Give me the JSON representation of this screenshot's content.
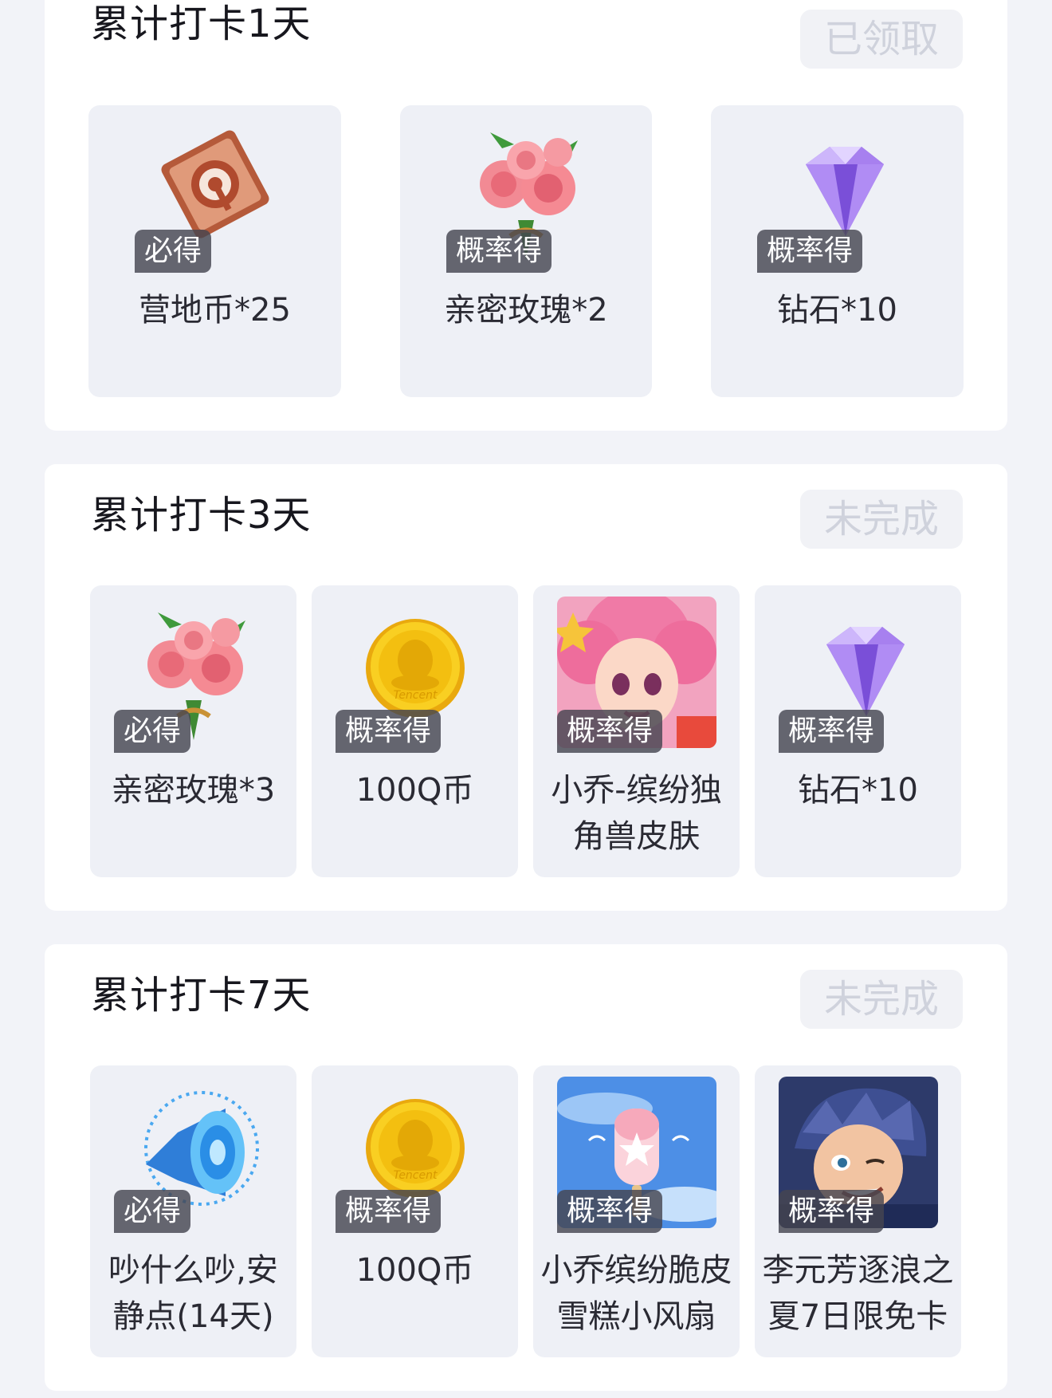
{
  "sections": [
    {
      "title": "累计打卡1天",
      "status": "已领取",
      "rewards": [
        {
          "tag": "必得",
          "label": "营地币*25",
          "icon": "camp-coin-icon"
        },
        {
          "tag": "概率得",
          "label": "亲密玫瑰*2",
          "icon": "rose-bouquet-icon"
        },
        {
          "tag": "概率得",
          "label": "钻石*10",
          "icon": "purple-diamond-icon"
        }
      ]
    },
    {
      "title": "累计打卡3天",
      "status": "未完成",
      "rewards": [
        {
          "tag": "必得",
          "label": "亲密玫瑰*3",
          "icon": "rose-bouquet-icon"
        },
        {
          "tag": "概率得",
          "label": "100Q币",
          "icon": "q-coin-icon"
        },
        {
          "tag": "概率得",
          "label": "小乔-缤纷独",
          "label2": "角兽皮肤",
          "icon": "xiaoqiao-skin-portrait"
        },
        {
          "tag": "概率得",
          "label": "钻石*10",
          "icon": "purple-diamond-icon"
        }
      ]
    },
    {
      "title": "累计打卡7天",
      "status": "未完成",
      "rewards": [
        {
          "tag": "必得",
          "label": "吵什么吵,安",
          "label2": "静点(14天)",
          "icon": "speaker-icon"
        },
        {
          "tag": "概率得",
          "label": "100Q币",
          "icon": "q-coin-icon"
        },
        {
          "tag": "概率得",
          "label": "小乔缤纷脆皮",
          "label2": "雪糕小风扇",
          "icon": "popsicle-fan-image"
        },
        {
          "tag": "概率得",
          "label": "李元芳逐浪之",
          "label2": "夏7日限免卡",
          "icon": "liyuanfang-portrait"
        }
      ]
    }
  ],
  "coin_watermark": "Tencent",
  "colors": {
    "page_bg": "#f2f3f8",
    "card_bg": "#ffffff",
    "item_bg": "#eef0f6",
    "status_disabled_text": "#cfd2dc",
    "tag_bg": "#4a4a52"
  }
}
